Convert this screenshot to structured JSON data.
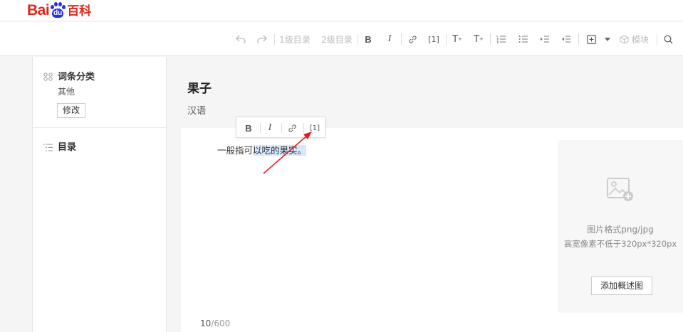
{
  "header": {
    "logo_text": "Bai",
    "logo_paw_text": "du",
    "logo_cn": "百科"
  },
  "toolbar": {
    "undo_icon": "undo-icon",
    "redo_icon": "redo-icon",
    "heading1_label": "1级目录",
    "heading2_label": "2级目录",
    "bold_label": "B",
    "italic_label": "I",
    "link_icon": "link-icon",
    "reference_label": "[1]",
    "superscript_label": "T",
    "subscript_label": "T",
    "ordered_list_icon": "ordered-list-icon",
    "unordered_list_icon": "unordered-list-icon",
    "indent_icon": "indent-icon",
    "outdent_icon": "outdent-icon",
    "insert_icon": "plus-box-icon",
    "dropdown_icon": "caret-down-icon",
    "module_label": "模块",
    "search_icon": "search-icon"
  },
  "sidebar": {
    "category_title": "词条分类",
    "category_value": "其他",
    "edit_button": "修改",
    "toc_title": "目录"
  },
  "main": {
    "title": "果子",
    "subtitle": "汉语",
    "paragraph_before": "一般指可",
    "paragraph_selected": "以吃的果实。",
    "counter_current": "10",
    "counter_max": "/600"
  },
  "float_toolbar": {
    "bold_label": "B",
    "italic_label": "I",
    "link_icon": "link-icon",
    "reference_label": "[1]"
  },
  "image_panel": {
    "icon": "image-add-icon",
    "hint_format": "图片格式png/jpg",
    "hint_size": "高宽像素不低于320px*320px",
    "add_button": "添加概述图"
  },
  "colors": {
    "brand_red": "#e1251b",
    "brand_blue": "#2932e1",
    "selection": "#d4e7fb",
    "annotation_arrow": "#e02020"
  }
}
